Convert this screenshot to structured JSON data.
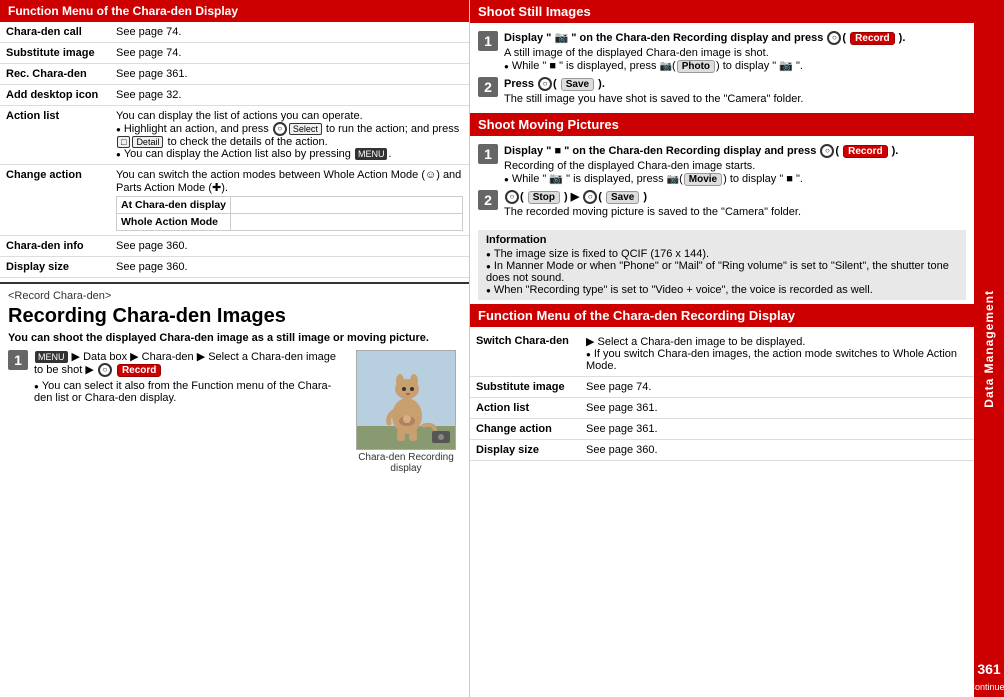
{
  "page": {
    "number": "361",
    "sidebar_label": "Data Management",
    "continued": "Continued"
  },
  "left_section": {
    "function_menu_header": "Function Menu of the Chara-den Display",
    "table_rows": [
      {
        "label": "Chara-den call",
        "value": "See page 74."
      },
      {
        "label": "Substitute image",
        "value": "See page 74."
      },
      {
        "label": "Rec. Chara-den",
        "value": "See page 361."
      },
      {
        "label": "Add desktop icon",
        "value": "See page 32."
      },
      {
        "label": "Action list",
        "value": "You can display the list of actions you can operate.",
        "bullets": [
          "Highlight an action, and press ○(Select) to run the action; and press □(Detail) to check the details of the action.",
          "You can display the Action list also by pressing MENU."
        ]
      },
      {
        "label": "Change action",
        "value": "You can switch the action modes between Whole Action Mode (☺) and Parts Action Mode (✚).",
        "sub_rows": [
          {
            "label": "At Chara-den display",
            "value": ""
          },
          {
            "label": "Whole Action Mode",
            "value": ""
          }
        ]
      },
      {
        "label": "Chara-den info",
        "value": "See page 360."
      },
      {
        "label": "Display size",
        "value": "See page 360."
      }
    ],
    "record_section": {
      "tag": "<Record Chara-den>",
      "title": "Recording Chara-den Images",
      "subtitle": "You can shoot the displayed Chara-den image as a still image or moving picture.",
      "step1": {
        "number": "1",
        "text": "MENU ▶ Data box ▶ Chara-den ▶ Select a Chara-den image to be shot ▶ ",
        "button": "Record",
        "bullets": [
          "You can select it also from the Function menu of the Chara-den list or Chara-den display."
        ]
      },
      "image_caption": "Chara-den Recording display"
    }
  },
  "right_section": {
    "shoot_still": {
      "header": "Shoot Still Images",
      "step1": {
        "number": "1",
        "title": "Display \" 📷 \" on the Chara-den Recording display and press ○( Record ).",
        "body": "A still image of the displayed Chara-den image is shot.",
        "bullets": [
          "While \" ■ \" is displayed, press 📷(Photo) to display \" 📷 \"."
        ]
      },
      "step2": {
        "number": "2",
        "title": "Press ○( Save ).",
        "body": "The still image you have shot is saved to the \"Camera\" folder."
      }
    },
    "shoot_moving": {
      "header": "Shoot Moving Pictures",
      "step1": {
        "number": "1",
        "title": "Display \" ■ \" on the Chara-den Recording display and press ○( Record ).",
        "body": "Recording of the displayed Chara-den image starts.",
        "bullets": [
          "While \" 📷 \" is displayed, press 📷(Movie) to display \" ■ \"."
        ]
      },
      "step2": {
        "number": "2",
        "title": "○( Stop ) ▶ ○( Save )",
        "body": "The recorded moving picture is saved to the \"Camera\" folder."
      }
    },
    "information": {
      "header": "Information",
      "bullets": [
        "The image size is fixed to QCIF (176 x 144).",
        "In Manner Mode or when \"Phone\" or \"Mail\" of \"Ring volume\" is set to \"Silent\", the shutter tone does not sound.",
        "When \"Recording type\" is set to \"Video + voice\", the voice is recorded as well."
      ]
    },
    "function_menu": {
      "header": "Function Menu of the Chara-den Recording Display",
      "table_rows": [
        {
          "label": "Switch Chara-den",
          "value": "▶ Select a Chara-den image to be displayed.",
          "bullets": [
            "If you switch Chara-den images, the action mode switches to Whole Action Mode."
          ]
        },
        {
          "label": "Substitute image",
          "value": "See page 74."
        },
        {
          "label": "Action list",
          "value": "See page 361."
        },
        {
          "label": "Change action",
          "value": "See page 361."
        },
        {
          "label": "Display size",
          "value": "See page 360."
        }
      ]
    }
  }
}
